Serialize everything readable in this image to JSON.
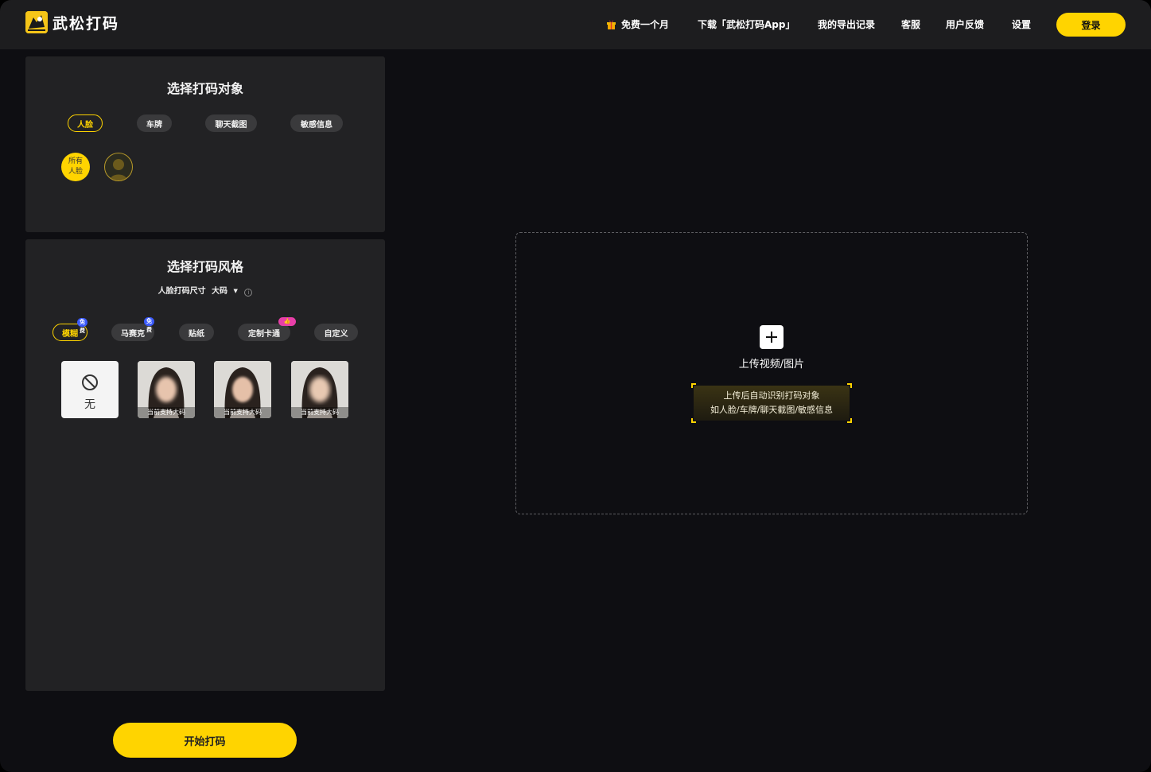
{
  "header": {
    "logo_text": "武松打码",
    "nav": {
      "free_month": "免费一个月",
      "download_app": "下载「武松打码App」",
      "export_records": "我的导出记录",
      "customer_service": "客服",
      "feedback": "用户反馈",
      "settings": "设置"
    },
    "login_label": "登录"
  },
  "target_panel": {
    "title": "选择打码对象",
    "tabs": [
      {
        "label": "人脸",
        "active": true
      },
      {
        "label": "车牌",
        "active": false
      },
      {
        "label": "聊天截图",
        "active": false
      },
      {
        "label": "敏感信息",
        "active": false
      }
    ],
    "all_faces_line1": "所有",
    "all_faces_line2": "人脸"
  },
  "style_panel": {
    "title": "选择打码风格",
    "size_label": "人脸打码尺寸",
    "size_value": "大码",
    "tabs": [
      {
        "label": "模糊",
        "active": true,
        "badge": "免费"
      },
      {
        "label": "马赛克",
        "active": false,
        "badge": "免费"
      },
      {
        "label": "贴纸",
        "active": false,
        "badge": ""
      },
      {
        "label": "定制卡通",
        "active": false,
        "badge": "👍"
      },
      {
        "label": "自定义",
        "active": false,
        "badge": ""
      }
    ],
    "none_label": "无",
    "thumb_caption": "当前支持大码"
  },
  "start_button": "开始打码",
  "upload": {
    "label": "上传视频/图片",
    "hint_line1": "上传后自动识别打码对象",
    "hint_line2": "如人脸/车牌/聊天截图/敏感信息"
  },
  "colors": {
    "accent": "#ffd400",
    "background": "#0e0e12",
    "panel": "#222224",
    "badge_blue": "#3b5bfd",
    "badge_pink": "#e83fa8"
  }
}
